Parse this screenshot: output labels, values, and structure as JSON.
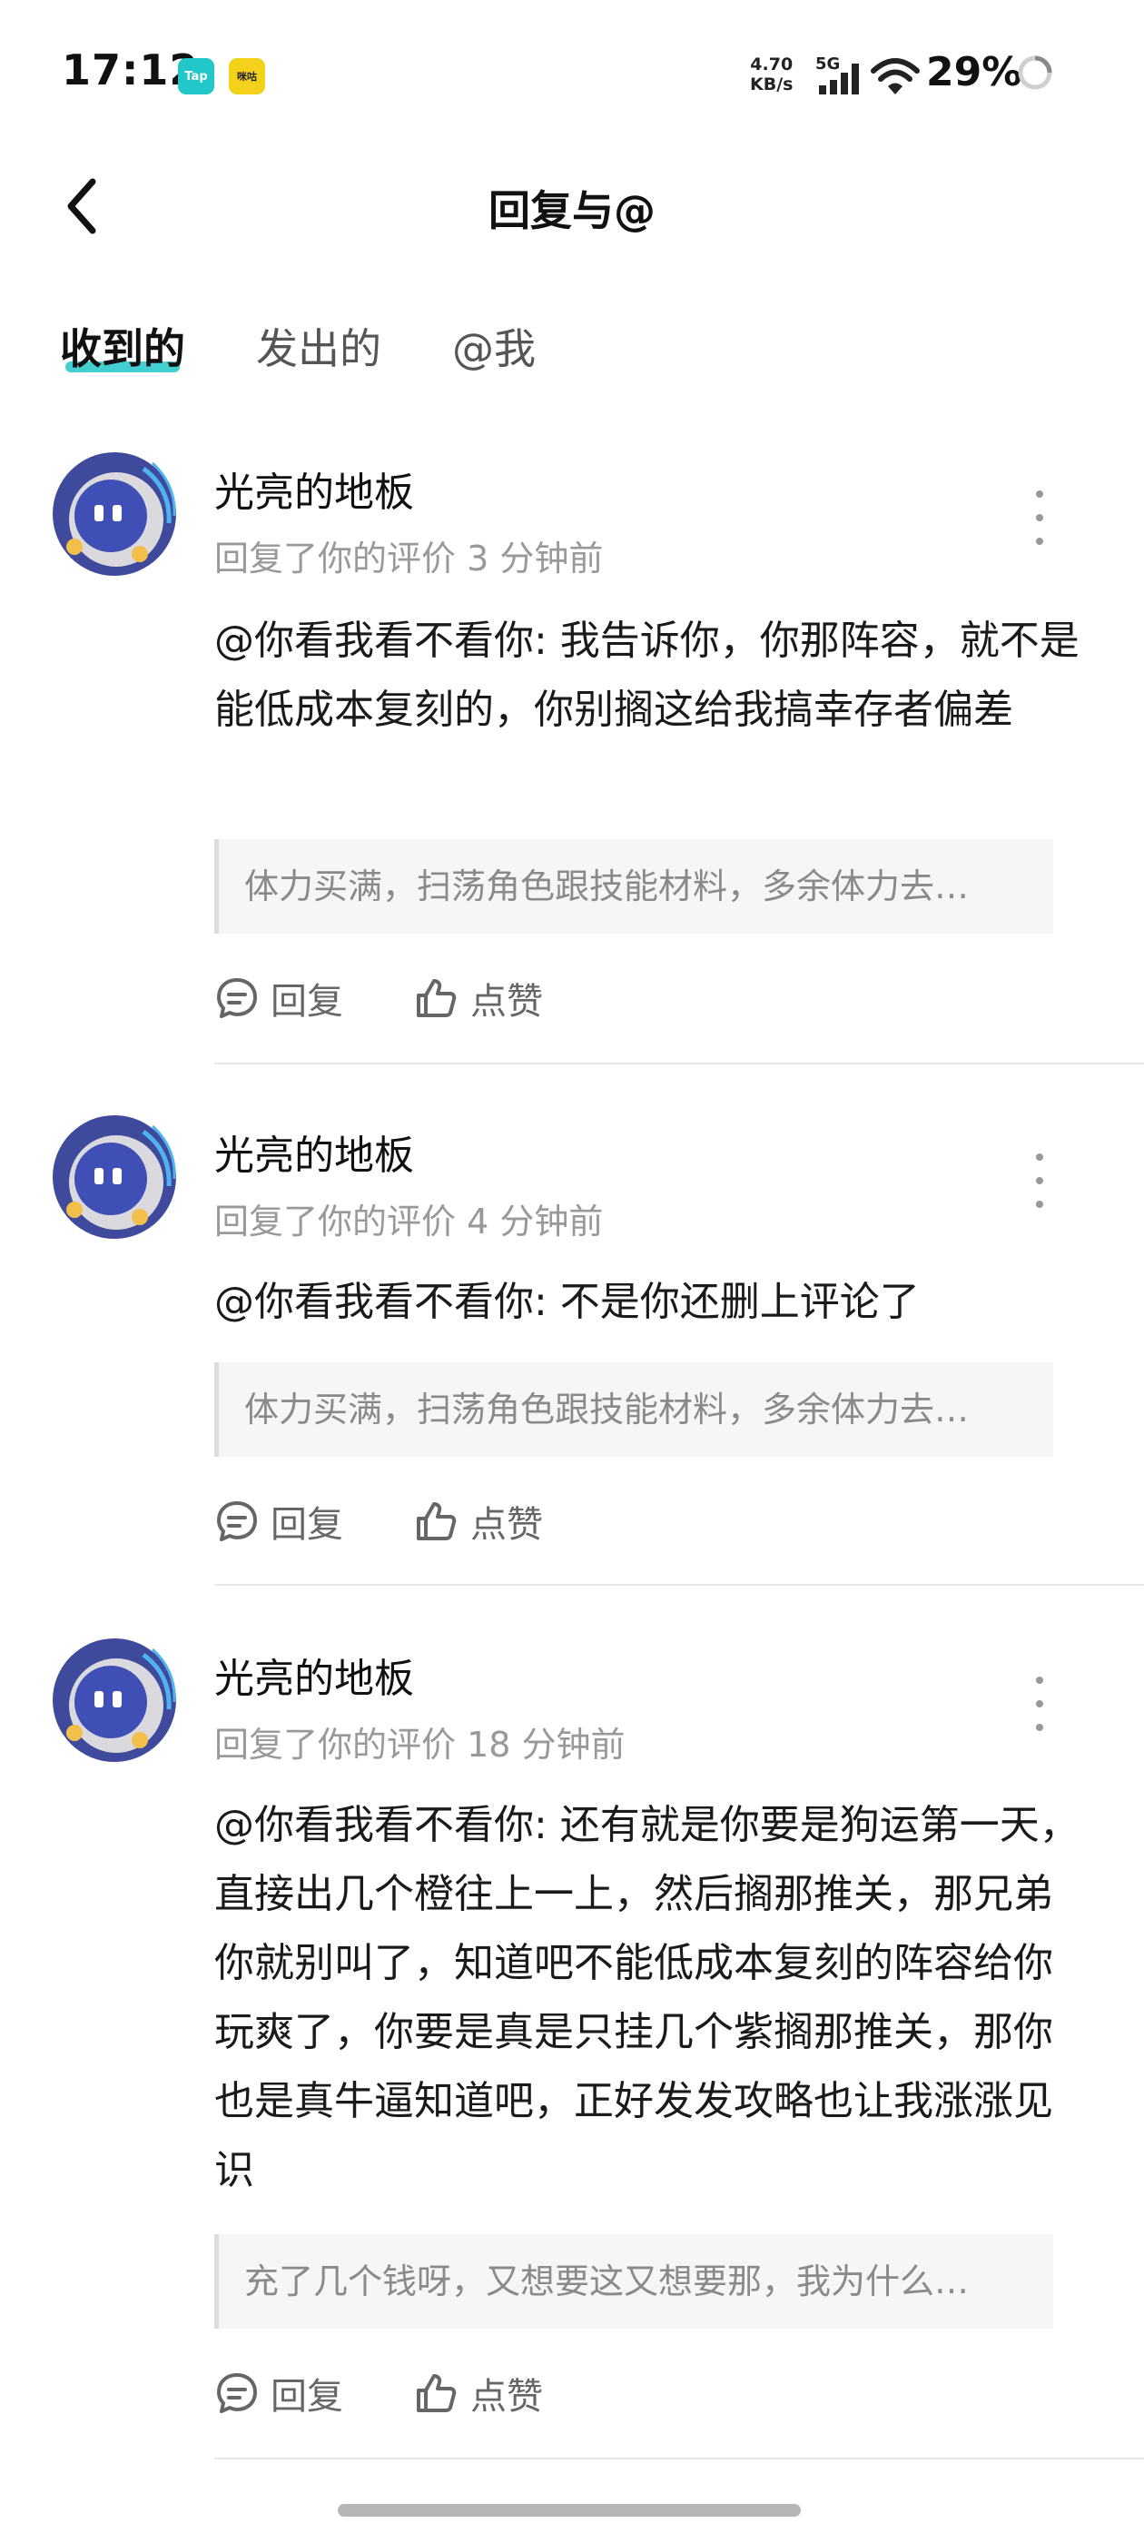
{
  "status_bar": {
    "time": "17:12",
    "app_icons": [
      {
        "label": "Tap",
        "color": "#22c7c9"
      },
      {
        "label": "咪咕",
        "color": "#f4d21c"
      }
    ],
    "net_speed_value": "4.70",
    "net_speed_unit": "KB/s",
    "network": "5G",
    "battery": "29%"
  },
  "header": {
    "back_icon": "chevron-left-icon",
    "title": "回复与@"
  },
  "tabs": [
    {
      "label": "收到的",
      "active": true
    },
    {
      "label": "发出的",
      "active": false
    },
    {
      "label": "@我",
      "active": false
    }
  ],
  "accent_color": "#22c7c9",
  "replies": [
    {
      "user": "光亮的地板",
      "meta": "回复了你的评价 3 分钟前",
      "body": "@你看我看不看你: 我告诉你，你那阵容，就不是能低成本复刻的，你别搁这给我搞幸存者偏差",
      "quote": "体力买满，扫荡角色跟技能材料，多余体力去…",
      "reply_label": "回复",
      "like_label": "点赞"
    },
    {
      "user": "光亮的地板",
      "meta": "回复了你的评价 4 分钟前",
      "body": "@你看我看不看你: 不是你还删上评论了",
      "quote": "体力买满，扫荡角色跟技能材料，多余体力去…",
      "reply_label": "回复",
      "like_label": "点赞"
    },
    {
      "user": "光亮的地板",
      "meta": "回复了你的评价 18 分钟前",
      "body": "@你看我看不看你: 还有就是你要是狗运第一天，直接出几个橙往上一上，然后搁那推关，那兄弟你就别叫了，知道吧不能低成本复刻的阵容给你玩爽了，你要是真是只挂几个紫搁那推关，那你也是真牛逼知道吧，正好发发攻略也让我涨涨见识",
      "quote": "充了几个钱呀，又想要这又想要那，我为什么…",
      "reply_label": "回复",
      "like_label": "点赞"
    }
  ]
}
